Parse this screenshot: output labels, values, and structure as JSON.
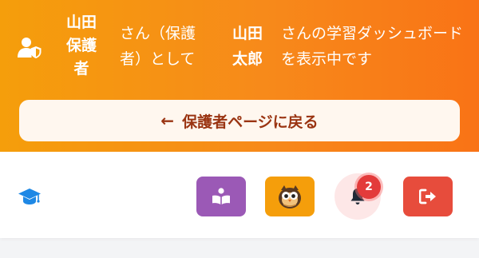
{
  "header": {
    "guardian_name": "山田保護者",
    "text_a": "さん（保護者）として",
    "child_name": "山田太郎",
    "text_b": "さんの学習ダッシュボードを表示中です",
    "guardian_icon": "user-shield-icon",
    "back_button": {
      "arrow": "←",
      "label": "保護者ページに戻る",
      "icon": "arrow-left-icon"
    }
  },
  "navbar": {
    "logo_icon": "graduation-cap-icon",
    "buttons": [
      {
        "name": "study-button",
        "icon": "book-reader-icon",
        "color": "#9b59b6"
      },
      {
        "name": "avatar-button",
        "icon": "character-avatar-icon",
        "color": "#f59e0b"
      },
      {
        "name": "notifications-button",
        "icon": "bell-icon",
        "color": "#fde7e7"
      },
      {
        "name": "logout-button",
        "icon": "sign-out-icon",
        "color": "#e74c3c"
      }
    ],
    "notification_count": "2"
  },
  "colors": {
    "banner_start": "#f59e0b",
    "banner_end": "#f97316",
    "back_text": "#9a3412",
    "logo_blue": "#1e88e5",
    "badge": "#e33b3b"
  }
}
